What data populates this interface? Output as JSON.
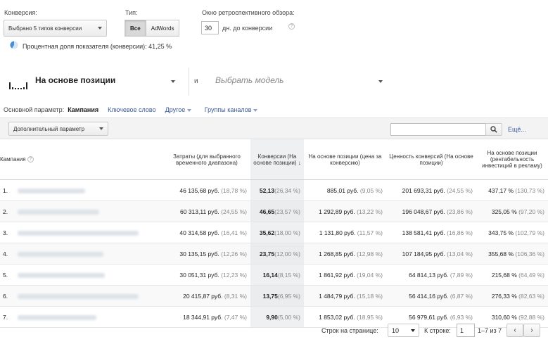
{
  "filters": {
    "conversion_label": "Конверсия:",
    "conversion_value": "Выбрано 5 типов конверсии",
    "type_label": "Тип:",
    "type_options": [
      "Все",
      "AdWords"
    ],
    "window_label": "Окно ретроспективного обзора:",
    "window_value": "30",
    "window_suffix": "дн. до конверсии",
    "share_text": "Процентная доля показателя (конверсии): 41,25 %"
  },
  "model": {
    "primary": "На основе позиции",
    "connector": "и",
    "secondary_placeholder": "Выбрать модель"
  },
  "dimension": {
    "label": "Основной параметр:",
    "active": "Кампания",
    "links": [
      "Ключевое слово",
      "Другое",
      "Группы каналов"
    ]
  },
  "toolbar": {
    "secondary_dim": "Дополнительный параметр",
    "search_placeholder": "",
    "more": "Ещё..."
  },
  "table": {
    "headers": [
      "Кампания",
      "Затраты (для выбранного временного диапазона)",
      "Конверсии (На основе позиции)",
      "На основе позиции (цена за конверсию)",
      "Ценность конверсий (На основе позиции)",
      "На основе позиции (рентабельность инвестиций в рекламу)"
    ],
    "rows": [
      {
        "n": "1.",
        "cost": "46 135,68 руб.",
        "cost_p": "(18,78 %)",
        "conv": "52,13",
        "conv_p": "(26,34 %)",
        "cpa": "885,01 руб.",
        "cpa_p": "(9,05 %)",
        "val": "201 693,31 руб.",
        "val_p": "(24,55 %)",
        "roas": "437,17 %",
        "roas_p": "(130,73 %)"
      },
      {
        "n": "2.",
        "cost": "60 313,11 руб.",
        "cost_p": "(24,55 %)",
        "conv": "46,65",
        "conv_p": "(23,57 %)",
        "cpa": "1 292,89 руб.",
        "cpa_p": "(13,22 %)",
        "val": "196 048,67 руб.",
        "val_p": "(23,86 %)",
        "roas": "325,05 %",
        "roas_p": "(97,20 %)"
      },
      {
        "n": "3.",
        "cost": "40 314,58 руб.",
        "cost_p": "(16,41 %)",
        "conv": "35,62",
        "conv_p": "(18,00 %)",
        "cpa": "1 131,80 руб.",
        "cpa_p": "(11,57 %)",
        "val": "138 581,41 руб.",
        "val_p": "(16,86 %)",
        "roas": "343,75 %",
        "roas_p": "(102,79 %)"
      },
      {
        "n": "4.",
        "cost": "30 135,15 руб.",
        "cost_p": "(12,26 %)",
        "conv": "23,75",
        "conv_p": "(12,00 %)",
        "cpa": "1 268,85 руб.",
        "cpa_p": "(12,98 %)",
        "val": "107 184,95 руб.",
        "val_p": "(13,04 %)",
        "roas": "355,68 %",
        "roas_p": "(106,36 %)"
      },
      {
        "n": "5.",
        "cost": "30 051,31 руб.",
        "cost_p": "(12,23 %)",
        "conv": "16,14",
        "conv_p": "(8,15 %)",
        "cpa": "1 861,92 руб.",
        "cpa_p": "(19,04 %)",
        "val": "64 814,13 руб.",
        "val_p": "(7,89 %)",
        "roas": "215,68 %",
        "roas_p": "(64,49 %)"
      },
      {
        "n": "6.",
        "cost": "20 415,87 руб.",
        "cost_p": "(8,31 %)",
        "conv": "13,75",
        "conv_p": "(6,95 %)",
        "cpa": "1 484,79 руб.",
        "cpa_p": "(15,18 %)",
        "val": "56 414,16 руб.",
        "val_p": "(6,87 %)",
        "roas": "276,33 %",
        "roas_p": "(82,63 %)"
      },
      {
        "n": "7.",
        "cost": "18 344,91 руб.",
        "cost_p": "(7,47 %)",
        "conv": "9,90",
        "conv_p": "(5,00 %)",
        "cpa": "1 853,02 руб.",
        "cpa_p": "(18,95 %)",
        "val": "56 979,61 руб.",
        "val_p": "(6,93 %)",
        "roas": "310,60 %",
        "roas_p": "(92,88 %)"
      }
    ]
  },
  "pagination": {
    "rows_label": "Строк на странице:",
    "rows_value": "10",
    "goto_label": "К строке:",
    "goto_value": "1",
    "range": "1–7 из 7"
  },
  "colors": {
    "link": "#3a5b9a",
    "sort_column": "#eef0f2",
    "pie_blue": "#4a8fd4"
  }
}
